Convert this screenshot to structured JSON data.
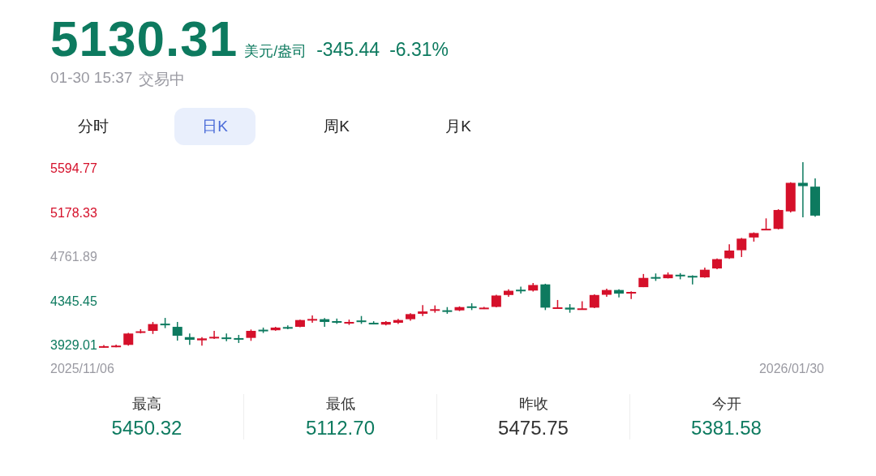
{
  "quote": {
    "price": "5130.31",
    "unit": "美元/盎司",
    "change": "-345.44",
    "change_pct": "-6.31%",
    "time": "01-30 15:37",
    "status": "交易中"
  },
  "tabs": [
    {
      "label": "分时",
      "selected": false
    },
    {
      "label": "日K",
      "selected": true
    },
    {
      "label": "周K",
      "selected": false
    },
    {
      "label": "月K",
      "selected": false
    }
  ],
  "chart": {
    "start_date": "2025/11/06",
    "end_date": "2026/01/30",
    "chart_data": {
      "type": "candlestick",
      "ylim": [
        3929.01,
        5594.77
      ],
      "yticks": [
        {
          "value": 5594.77,
          "label": "5594.77"
        },
        {
          "value": 5178.33,
          "label": "5178.33"
        },
        {
          "value": 4761.89,
          "label": "4761.89"
        },
        {
          "value": 4345.45,
          "label": "4345.45"
        },
        {
          "value": 3929.01,
          "label": "3929.01"
        }
      ],
      "categories": [
        null,
        null,
        null,
        null,
        null,
        null,
        null,
        null,
        null,
        null,
        null,
        null,
        null,
        null,
        null,
        null,
        null,
        null,
        null,
        null,
        null,
        null,
        null,
        null,
        null,
        null,
        null,
        null,
        null,
        null,
        null,
        null,
        null,
        null,
        null,
        null,
        null,
        null,
        null,
        null,
        null,
        null,
        null,
        null,
        null,
        null,
        null,
        null,
        null,
        null,
        null,
        null,
        null,
        null,
        null,
        null,
        null,
        null,
        null
      ],
      "ohlc": [
        [
          3925,
          3940,
          3915,
          3930
        ],
        [
          3928,
          3945,
          3920,
          3935
        ],
        [
          3942,
          4055,
          3935,
          4049
        ],
        [
          4060,
          4090,
          4050,
          4070
        ],
        [
          4074,
          4158,
          4045,
          4138
        ],
        [
          4142,
          4196,
          4100,
          4134
        ],
        [
          4112,
          4158,
          3982,
          4028
        ],
        [
          4015,
          4050,
          3942,
          3990
        ],
        [
          3985,
          4015,
          3935,
          4003
        ],
        [
          4012,
          4074,
          3997,
          4018
        ],
        [
          4012,
          4049,
          3977,
          4008
        ],
        [
          4006,
          4036,
          3960,
          4000
        ],
        [
          4008,
          4087,
          3980,
          4074
        ],
        [
          4085,
          4105,
          4054,
          4080
        ],
        [
          4080,
          4112,
          4075,
          4105
        ],
        [
          4110,
          4125,
          4090,
          4105
        ],
        [
          4112,
          4180,
          4108,
          4176
        ],
        [
          4180,
          4220,
          4150,
          4186
        ],
        [
          4184,
          4194,
          4112,
          4158
        ],
        [
          4166,
          4190,
          4140,
          4160
        ],
        [
          4152,
          4180,
          4130,
          4158
        ],
        [
          4172,
          4214,
          4140,
          4165
        ],
        [
          4150,
          4165,
          4135,
          4146
        ],
        [
          4133,
          4165,
          4125,
          4158
        ],
        [
          4150,
          4186,
          4140,
          4176
        ],
        [
          4184,
          4240,
          4170,
          4232
        ],
        [
          4235,
          4316,
          4214,
          4257
        ],
        [
          4270,
          4314,
          4245,
          4278
        ],
        [
          4268,
          4298,
          4235,
          4262
        ],
        [
          4267,
          4305,
          4260,
          4298
        ],
        [
          4305,
          4334,
          4270,
          4298
        ],
        [
          4288,
          4300,
          4280,
          4293
        ],
        [
          4300,
          4415,
          4295,
          4407
        ],
        [
          4412,
          4466,
          4395,
          4452
        ],
        [
          4462,
          4490,
          4425,
          4456
        ],
        [
          4454,
          4525,
          4445,
          4506
        ],
        [
          4512,
          4518,
          4270,
          4293
        ],
        [
          4290,
          4365,
          4285,
          4296
        ],
        [
          4293,
          4326,
          4245,
          4275
        ],
        [
          4282,
          4353,
          4275,
          4286
        ],
        [
          4293,
          4418,
          4288,
          4412
        ],
        [
          4414,
          4472,
          4395,
          4459
        ],
        [
          4459,
          4466,
          4390,
          4425
        ],
        [
          4427,
          4447,
          4375,
          4441
        ],
        [
          4486,
          4610,
          4486,
          4573
        ],
        [
          4581,
          4615,
          4545,
          4575
        ],
        [
          4570,
          4625,
          4568,
          4605
        ],
        [
          4603,
          4618,
          4560,
          4597
        ],
        [
          4592,
          4597,
          4512,
          4578
        ],
        [
          4578,
          4670,
          4575,
          4650
        ],
        [
          4662,
          4757,
          4655,
          4750
        ],
        [
          4758,
          4890,
          4752,
          4831
        ],
        [
          4834,
          4950,
          4770,
          4943
        ],
        [
          4954,
          5002,
          4915,
          4996
        ],
        [
          5030,
          5134,
          5025,
          5036
        ],
        [
          5035,
          5220,
          5030,
          5213
        ],
        [
          5200,
          5475,
          5190,
          5469
        ],
        [
          5469,
          5664,
          5144,
          5438
        ],
        [
          5433,
          5511,
          5150,
          5160
        ]
      ]
    }
  },
  "stats": [
    {
      "label": "最高",
      "value": "5450.32",
      "color": "#0d7a5f"
    },
    {
      "label": "最低",
      "value": "5112.70",
      "color": "#0d7a5f"
    },
    {
      "label": "昨收",
      "value": "5475.75",
      "color": "#333333"
    },
    {
      "label": "今开",
      "value": "5381.58",
      "color": "#0d7a5f"
    }
  ]
}
